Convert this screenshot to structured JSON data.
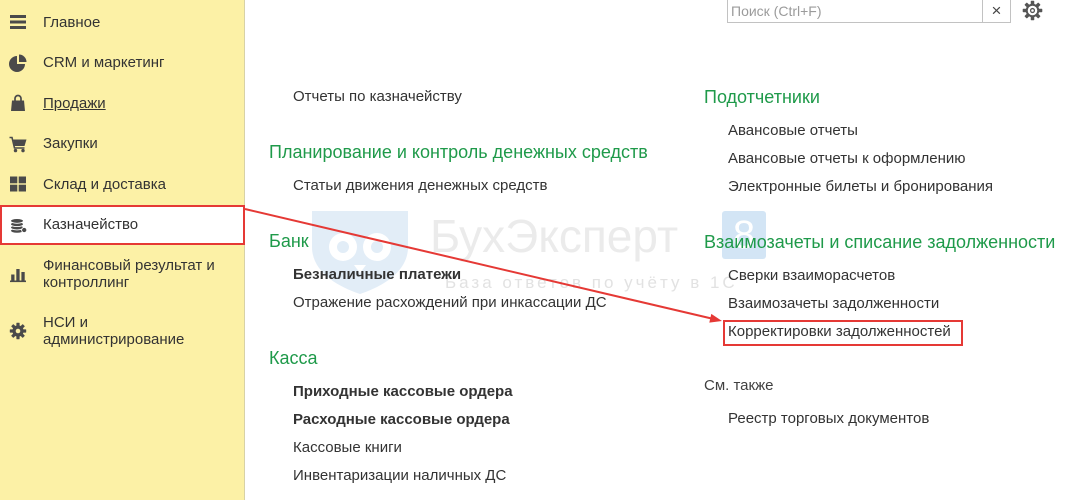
{
  "sidebar": {
    "items": [
      {
        "label": "Главное",
        "icon": "menu-icon"
      },
      {
        "label": "CRM и маркетинг",
        "icon": "pie-chart-icon"
      },
      {
        "label": "Продажи",
        "icon": "shopping-bag-icon"
      },
      {
        "label": "Закупки",
        "icon": "cart-icon"
      },
      {
        "label": "Склад и доставка",
        "icon": "warehouse-icon"
      },
      {
        "label": "Казначейство",
        "icon": "coins-icon",
        "active": true
      },
      {
        "label": "Финансовый результат и\nконтроллинг",
        "icon": "bar-chart-icon"
      },
      {
        "label": "НСИ и\nадминистрирование",
        "icon": "settings-icon"
      }
    ]
  },
  "search": {
    "placeholder": "Поиск (Ctrl+F)",
    "clear_label": "×",
    "settings_icon": "gear-icon"
  },
  "content": {
    "left": {
      "reports_link": "Отчеты по казначейству",
      "planning": {
        "title": "Планирование и контроль денежных средств",
        "items": [
          "Статьи движения денежных средств"
        ]
      },
      "bank": {
        "title": "Банк",
        "items": [
          "Безналичные платежи",
          "Отражение расхождений при инкассации ДС"
        ]
      },
      "cash": {
        "title": "Касса",
        "items": [
          "Приходные кассовые ордера",
          "Расходные кассовые ордера",
          "Кассовые книги",
          "Инвентаризации наличных ДС"
        ]
      }
    },
    "right": {
      "accountable": {
        "title": "Подотчетники",
        "items": [
          "Авансовые отчеты",
          "Авансовые отчеты к оформлению",
          "Электронные билеты и бронирования"
        ]
      },
      "offsets": {
        "title": "Взаимозачеты и списание задолженности",
        "items": [
          "Сверки взаиморасчетов",
          "Взаимозачеты задолженности",
          "Корректировки задолженностей"
        ]
      },
      "see_also": {
        "title": "См. также",
        "items": [
          "Реестр торговых документов"
        ]
      }
    }
  },
  "watermark": {
    "brand": "БухЭксперт",
    "digit": "8",
    "tagline": "База ответов по учёту в 1С"
  },
  "colors": {
    "sidebar_bg": "#fcf1a6",
    "section_heading": "#1f9a4a",
    "annotation": "#e53935",
    "text": "#333333"
  }
}
